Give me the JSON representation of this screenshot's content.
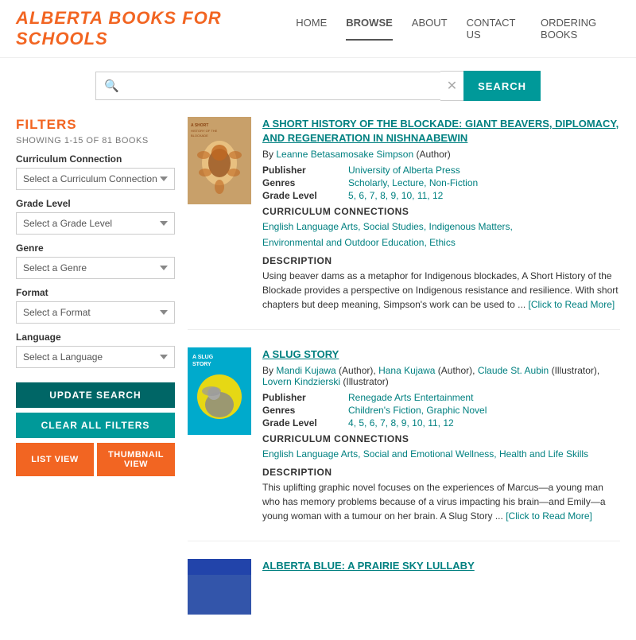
{
  "header": {
    "title": "ALBERTA BOOKS FOR SCHOOLS",
    "nav": [
      {
        "label": "HOME",
        "active": false
      },
      {
        "label": "BROWSE",
        "active": true
      },
      {
        "label": "ABOUT",
        "active": false
      },
      {
        "label": "CONTACT US",
        "active": false
      },
      {
        "label": "ORDERING BOOKS",
        "active": false
      }
    ]
  },
  "search": {
    "placeholder": "",
    "value": "",
    "button_label": "SEARCH",
    "clear_icon": "✕"
  },
  "sidebar": {
    "filters_label": "FILTERS",
    "showing_text": "SHOWING 1-15 OF 81 BOOKS",
    "filters": [
      {
        "label": "Curriculum Connection",
        "placeholder": "Select a Curriculum Connection"
      },
      {
        "label": "Grade Level",
        "placeholder": "Select a Grade Level"
      },
      {
        "label": "Genre",
        "placeholder": "Select a Genre"
      },
      {
        "label": "Format",
        "placeholder": "Select a Format"
      },
      {
        "label": "Language",
        "placeholder": "Select a Language"
      }
    ],
    "update_btn": "UPDATE SEARCH",
    "clear_btn": "CLEAR ALL FILTERS",
    "list_view_btn": "LIST VIEW",
    "thumbnail_view_btn": "THUMBNAIL VIEW"
  },
  "books": [
    {
      "title": "A SHORT HISTORY OF THE BLOCKADE: GIANT BEAVERS, DIPLOMACY, AND REGENERATION IN NISHNAABEWIN",
      "author_label": "By",
      "authors": [
        {
          "name": "Leanne Betasamosake Simpson",
          "role": "(Author)"
        }
      ],
      "publisher_label": "Publisher",
      "publisher": "University of Alberta Press",
      "genres_label": "Genres",
      "genres": [
        "Scholarly",
        "Lecture",
        "Non-Fiction"
      ],
      "grade_label": "Grade Level",
      "grades": [
        "5",
        "6",
        "7",
        "8",
        "9",
        "10",
        "11",
        "12"
      ],
      "curriculum_head": "CURRICULUM CONNECTIONS",
      "curriculum": [
        "English Language Arts",
        "Social Studies",
        "Indigenous Matters",
        "Environmental and Outdoor Education",
        "Ethics"
      ],
      "description_head": "DESCRIPTION",
      "description": "Using beaver dams as a metaphor for Indigenous blockades, A Short History of the Blockade provides a perspective on Indigenous resistance and resilience. With short chapters but deep meaning, Simpson's work can be used to ...",
      "read_more": "[Click to Read More]"
    },
    {
      "title": "A SLUG STORY",
      "author_label": "By",
      "authors": [
        {
          "name": "Mandi Kujawa",
          "role": "(Author),"
        },
        {
          "name": "Hana Kujawa",
          "role": "(Author),"
        },
        {
          "name": "Claude St. Aubin",
          "role": "(Illustrator),"
        },
        {
          "name": "Lovern Kindzierski",
          "role": "(Illustrator)"
        }
      ],
      "publisher_label": "Publisher",
      "publisher": "Renegade Arts Entertainment",
      "genres_label": "Genres",
      "genres": [
        "Children's Fiction",
        "Graphic Novel"
      ],
      "grade_label": "Grade Level",
      "grades": [
        "4",
        "5",
        "6",
        "7",
        "8",
        "9",
        "10",
        "11",
        "12"
      ],
      "curriculum_head": "CURRICULUM CONNECTIONS",
      "curriculum": [
        "English Language Arts",
        "Social and Emotional Wellness",
        "Health and Life Skills"
      ],
      "description_head": "DESCRIPTION",
      "description": "This uplifting graphic novel focuses on the experiences of Marcus—a young man who has memory problems because of a virus impacting his brain—and Emily—a young woman with a tumour on her brain. A Slug Story ...",
      "read_more": "[Click to Read More]"
    },
    {
      "title": "ALBERTA BLUE: A PRAIRIE SKY LULLABY",
      "author_label": "",
      "authors": [],
      "publisher_label": "",
      "publisher": "",
      "genres_label": "",
      "genres": [],
      "grade_label": "",
      "grades": [],
      "curriculum_head": "",
      "curriculum": [],
      "description_head": "",
      "description": "",
      "read_more": ""
    }
  ]
}
